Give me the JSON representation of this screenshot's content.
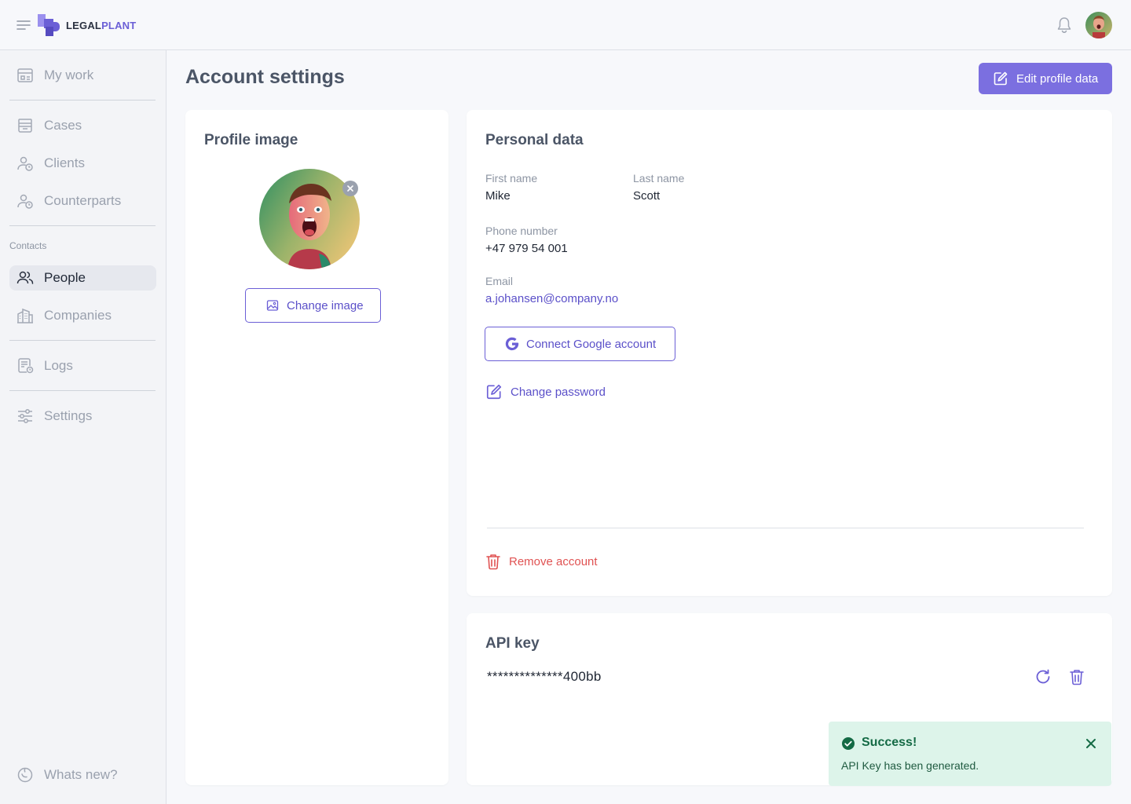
{
  "app": {
    "logo_part1": "LEGAL",
    "logo_part2": "PLANT"
  },
  "colors": {
    "accent": "#7b6fe0",
    "accent_text": "#5b50c9",
    "danger": "#e05252",
    "success_bg": "#ddf4ea",
    "success_text": "#146a45"
  },
  "sidebar": {
    "items": [
      {
        "label": "My work",
        "icon": "calendar-icon"
      },
      {
        "label": "Cases",
        "icon": "archive-icon"
      },
      {
        "label": "Clients",
        "icon": "user-clock-icon"
      },
      {
        "label": "Counterparts",
        "icon": "user-clock-icon"
      },
      {
        "label": "People",
        "icon": "users-icon",
        "active": true
      },
      {
        "label": "Companies",
        "icon": "building-icon"
      },
      {
        "label": "Logs",
        "icon": "log-icon"
      },
      {
        "label": "Settings",
        "icon": "sliders-icon"
      }
    ],
    "section_contacts": "Contacts",
    "whats_new": "Whats new?"
  },
  "page": {
    "title": "Account settings",
    "edit_button": "Edit profile data"
  },
  "profile_image": {
    "title": "Profile image",
    "change_button": "Change image"
  },
  "personal_data": {
    "title": "Personal data",
    "first_name_label": "First name",
    "first_name": "Mike",
    "last_name_label": "Last name",
    "last_name": "Scott",
    "phone_label": "Phone number",
    "phone": "+47 979 54 001",
    "email_label": "Email",
    "email": "a.johansen@company.no",
    "google_button": "Connect Google account",
    "change_password": "Change password",
    "remove_account": "Remove account"
  },
  "api_key": {
    "title": "API key",
    "value": "**************400bb"
  },
  "toast": {
    "title": "Success!",
    "message": "API Key has ben generated."
  }
}
